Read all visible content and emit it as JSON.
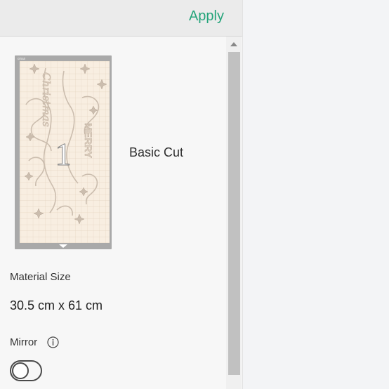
{
  "header": {
    "apply_label": "Apply"
  },
  "mat": {
    "number": "1",
    "name": "Basic Cut",
    "brand_text": "cricut",
    "design_title": "MERRY",
    "design_script": "Christmas"
  },
  "material_size": {
    "label": "Material Size",
    "value": "30.5 cm x 61 cm"
  },
  "mirror": {
    "label": "Mirror",
    "info_icon": "info-icon",
    "enabled": false
  },
  "colors": {
    "accent": "#24a47a",
    "mat_background": "#f8eee1",
    "mat_frame": "#a9a9a9"
  }
}
